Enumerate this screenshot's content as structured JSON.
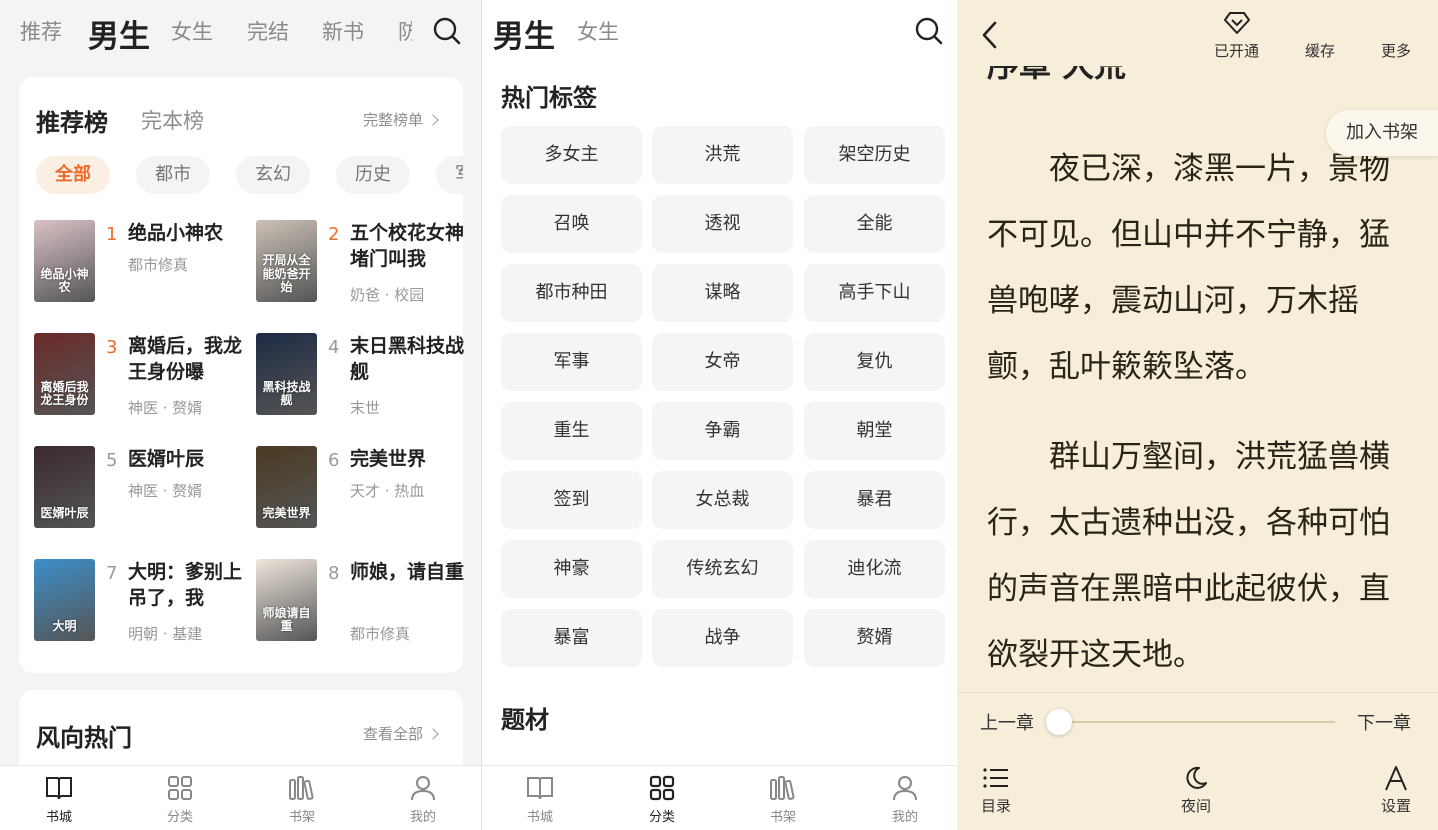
{
  "store": {
    "tabs": [
      "推荐",
      "男生",
      "女生",
      "完结",
      "新书",
      "防"
    ],
    "active_tab": "男生",
    "rank_card": {
      "title": "推荐榜",
      "subtab": "完本榜",
      "more": "完整榜单",
      "chips": [
        "全部",
        "都市",
        "玄幻",
        "历史",
        "军事"
      ],
      "books": [
        {
          "rank": "1",
          "title": "绝品小神农",
          "meta": "都市修真",
          "cover_text": "绝品小神农",
          "cover_bg": "#d9c2c6"
        },
        {
          "rank": "2",
          "title": "五个校花女神堵门叫我",
          "meta": "奶爸 · 校园",
          "cover_text": "开局从全能奶爸开始",
          "cover_bg": "#ccc1b6"
        },
        {
          "rank": "3",
          "title": "离婚后，我龙王身份曝",
          "meta": "神医 · 赘婿",
          "cover_text": "离婚后我龙王身份",
          "cover_bg": "#6b2a2a"
        },
        {
          "rank": "4",
          "title": "末日黑科技战舰",
          "meta": "末世",
          "cover_text": "黑科技战舰",
          "cover_bg": "#1d2b44"
        },
        {
          "rank": "5",
          "title": "医婿叶辰",
          "meta": "神医 · 赘婿",
          "cover_text": "医婿叶辰",
          "cover_bg": "#3a2a2e"
        },
        {
          "rank": "6",
          "title": "完美世界",
          "meta": "天才 · 热血",
          "cover_text": "完美世界",
          "cover_bg": "#4a3a22"
        },
        {
          "rank": "7",
          "title": "大明：爹别上吊了，我",
          "meta": "明朝 · 基建",
          "cover_text": "大明",
          "cover_bg": "#3c8fc9"
        },
        {
          "rank": "8",
          "title": "师娘，请自重",
          "meta": "都市修真",
          "cover_text": "师娘请自重",
          "cover_bg": "#efe6dc"
        }
      ]
    },
    "trend_card": {
      "title": "风向热门",
      "more": "查看全部"
    },
    "bottom_nav": [
      "书城",
      "分类",
      "书架",
      "我的"
    ],
    "active_bottom": "书城"
  },
  "category": {
    "tabs": [
      "男生",
      "女生"
    ],
    "active_tab": "男生",
    "hot_tags_title": "热门标签",
    "tags": [
      "多女主",
      "洪荒",
      "架空历史",
      "召唤",
      "透视",
      "全能",
      "都市种田",
      "谋略",
      "高手下山",
      "军事",
      "女帝",
      "复仇",
      "重生",
      "争霸",
      "朝堂",
      "签到",
      "女总裁",
      "暴君",
      "神豪",
      "传统玄幻",
      "迪化流",
      "暴富",
      "战争",
      "赘婿"
    ],
    "theme_title": "题材",
    "bottom_nav": [
      "书城",
      "分类",
      "书架",
      "我的"
    ],
    "active_bottom": "分类"
  },
  "reader": {
    "header": {
      "vip": "已开通",
      "cache": "缓存",
      "more": "更多"
    },
    "chapter_title": "序章 大荒",
    "add_to_shelf": "加入书架",
    "paragraphs": [
      "夜已深，漆黑一片，景物不可见。但山中并不宁静，猛兽咆哮，震动山河，万木摇颤，乱叶簌簌坠落。",
      "群山万壑间，洪荒猛兽横行，太古遗种出没，各种可怕的声音在黑暗中此起彼伏，直欲裂开这天地。"
    ],
    "prev_chapter": "上一章",
    "next_chapter": "下一章",
    "progress": 0,
    "bottom": {
      "toc": "目录",
      "night": "夜间",
      "settings": "设置"
    }
  },
  "colors": {
    "accent": "#ef6b2a",
    "reader_bg": "#f6eed8",
    "tag_bg": "#f5f5f5"
  }
}
